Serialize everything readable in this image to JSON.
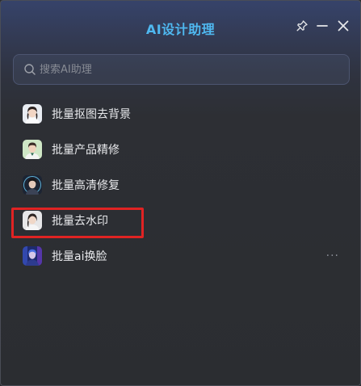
{
  "window": {
    "title": "AI设计助理",
    "title_color": "#4fb8f0"
  },
  "titlebar": {
    "icons": [
      "pin-icon",
      "minimize-icon",
      "close-icon"
    ]
  },
  "search": {
    "placeholder": "搜索AI助理",
    "value": ""
  },
  "assistants": [
    {
      "label": "批量抠图去背景",
      "avatar_icon": "avatar-woman-white-shirt"
    },
    {
      "label": "批量产品精修",
      "avatar_icon": "avatar-man-green"
    },
    {
      "label": "批量高清修复",
      "avatar_icon": "avatar-woman-cyber"
    },
    {
      "label": "批量去水印",
      "avatar_icon": "avatar-woman-portrait",
      "highlighted": true
    },
    {
      "label": "批量ai换脸",
      "avatar_icon": "avatar-cyber-blue",
      "has_more": true
    }
  ],
  "more_label": "···",
  "colors": {
    "highlight_border": "#e02323",
    "text": "#e8e9ec"
  }
}
